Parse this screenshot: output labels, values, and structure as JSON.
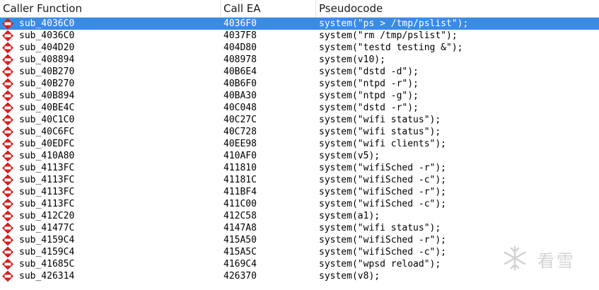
{
  "columns": {
    "caller": "Caller Function",
    "call_ea": "Call EA",
    "pseudocode": "Pseudocode"
  },
  "rows": [
    {
      "caller": "sub_4036C0",
      "ea": "4036F0",
      "code": "system(\"ps > /tmp/pslist\");",
      "selected": true
    },
    {
      "caller": "sub_4036C0",
      "ea": "4037F8",
      "code": "system(\"rm /tmp/pslist\");"
    },
    {
      "caller": "sub_404D20",
      "ea": "404D80",
      "code": "system(\"testd testing &\");"
    },
    {
      "caller": "sub_408894",
      "ea": "408978",
      "code": "system(v10);"
    },
    {
      "caller": "sub_40B270",
      "ea": "40B6E4",
      "code": "system(\"dstd -d\");"
    },
    {
      "caller": "sub_40B270",
      "ea": "40B6F0",
      "code": "system(\"ntpd -r\");"
    },
    {
      "caller": "sub_40B894",
      "ea": "40BA30",
      "code": "system(\"ntpd -g\");"
    },
    {
      "caller": "sub_40BE4C",
      "ea": "40C048",
      "code": "system(\"dstd -r\");"
    },
    {
      "caller": "sub_40C1C0",
      "ea": "40C27C",
      "code": "system(\"wifi status\");"
    },
    {
      "caller": "sub_40C6FC",
      "ea": "40C728",
      "code": "system(\"wifi status\");"
    },
    {
      "caller": "sub_40EDFC",
      "ea": "40EE98",
      "code": "system(\"wifi clients\");"
    },
    {
      "caller": "sub_410A80",
      "ea": "410AF0",
      "code": "system(v5);"
    },
    {
      "caller": "sub_4113FC",
      "ea": "411810",
      "code": "system(\"wifiSched -r\");"
    },
    {
      "caller": "sub_4113FC",
      "ea": "41181C",
      "code": "system(\"wifiSched -c\");"
    },
    {
      "caller": "sub_4113FC",
      "ea": "411BF4",
      "code": "system(\"wifiSched -r\");"
    },
    {
      "caller": "sub_4113FC",
      "ea": "411C00",
      "code": "system(\"wifiSched -c\");"
    },
    {
      "caller": "sub_412C20",
      "ea": "412C58",
      "code": "system(a1);"
    },
    {
      "caller": "sub_41477C",
      "ea": "4147A8",
      "code": "system(\"wifi status\");"
    },
    {
      "caller": "sub_4159C4",
      "ea": "415A50",
      "code": "system(\"wifiSched -r\");"
    },
    {
      "caller": "sub_4159C4",
      "ea": "415A5C",
      "code": "system(\"wifiSched -c\");"
    },
    {
      "caller": "sub_41685C",
      "ea": "4169C4",
      "code": "system(\"wpsd reload\");"
    },
    {
      "caller": "sub_426314",
      "ea": "426370",
      "code": "system(v8);"
    }
  ],
  "icon": "xref-diamond-icon",
  "colors": {
    "selection": "#3a8be6",
    "icon_red": "#d81e1e",
    "watermark": "#d3d3d3"
  },
  "watermark": {
    "text": "看雪",
    "icon": "snowflake-icon"
  }
}
